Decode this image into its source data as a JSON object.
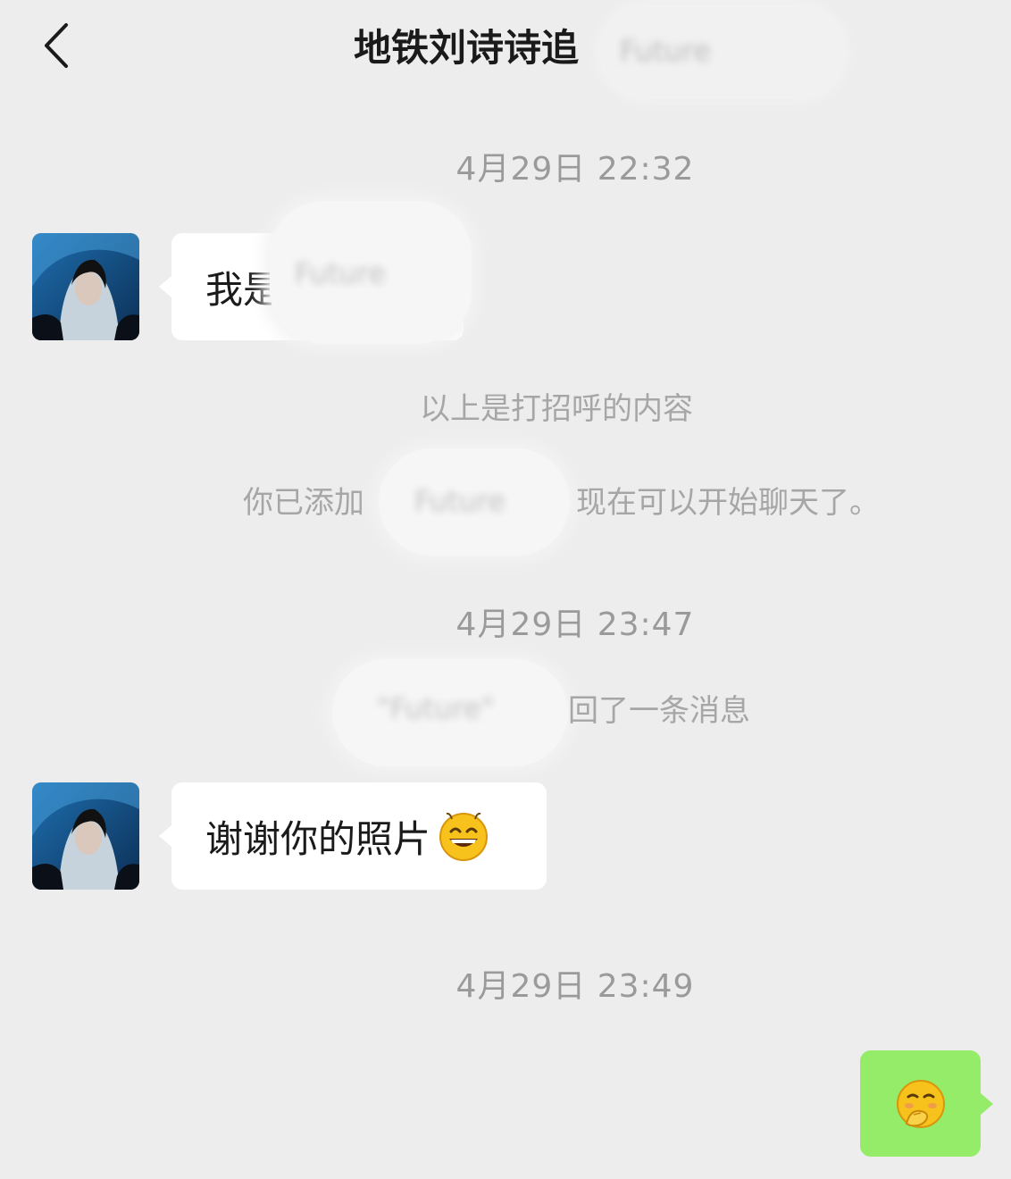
{
  "header": {
    "back_icon": "chevron-left-icon",
    "title": "地铁刘诗诗追",
    "title_redacted": "Future"
  },
  "messages": [
    {
      "type": "timestamp",
      "text": "4月29日 22:32"
    },
    {
      "type": "incoming",
      "text_visible": "我是",
      "text_redacted": "Future",
      "avatar": "profile-photo"
    },
    {
      "type": "system",
      "text": "以上是打招呼的内容"
    },
    {
      "type": "system",
      "text_prefix": "你已添加",
      "text_redacted": "Future",
      "text_suffix": "现在可以开始聊天了。"
    },
    {
      "type": "timestamp",
      "text": "4月29日 23:47"
    },
    {
      "type": "system",
      "text_redacted": "\"Future\"",
      "text_suffix": "回了一条消息"
    },
    {
      "type": "incoming",
      "text": "谢谢你的照片",
      "emoji": "grinning-face-icon",
      "avatar": "profile-photo"
    },
    {
      "type": "timestamp",
      "text": "4月29日 23:49"
    },
    {
      "type": "outgoing",
      "emoji": "shy-face-icon",
      "bubble_color": "#95ec69"
    }
  ],
  "colors": {
    "background": "#ededed",
    "incoming_bubble": "#ffffff",
    "outgoing_bubble": "#95ec69",
    "timestamp_text": "#9a9a9a"
  }
}
